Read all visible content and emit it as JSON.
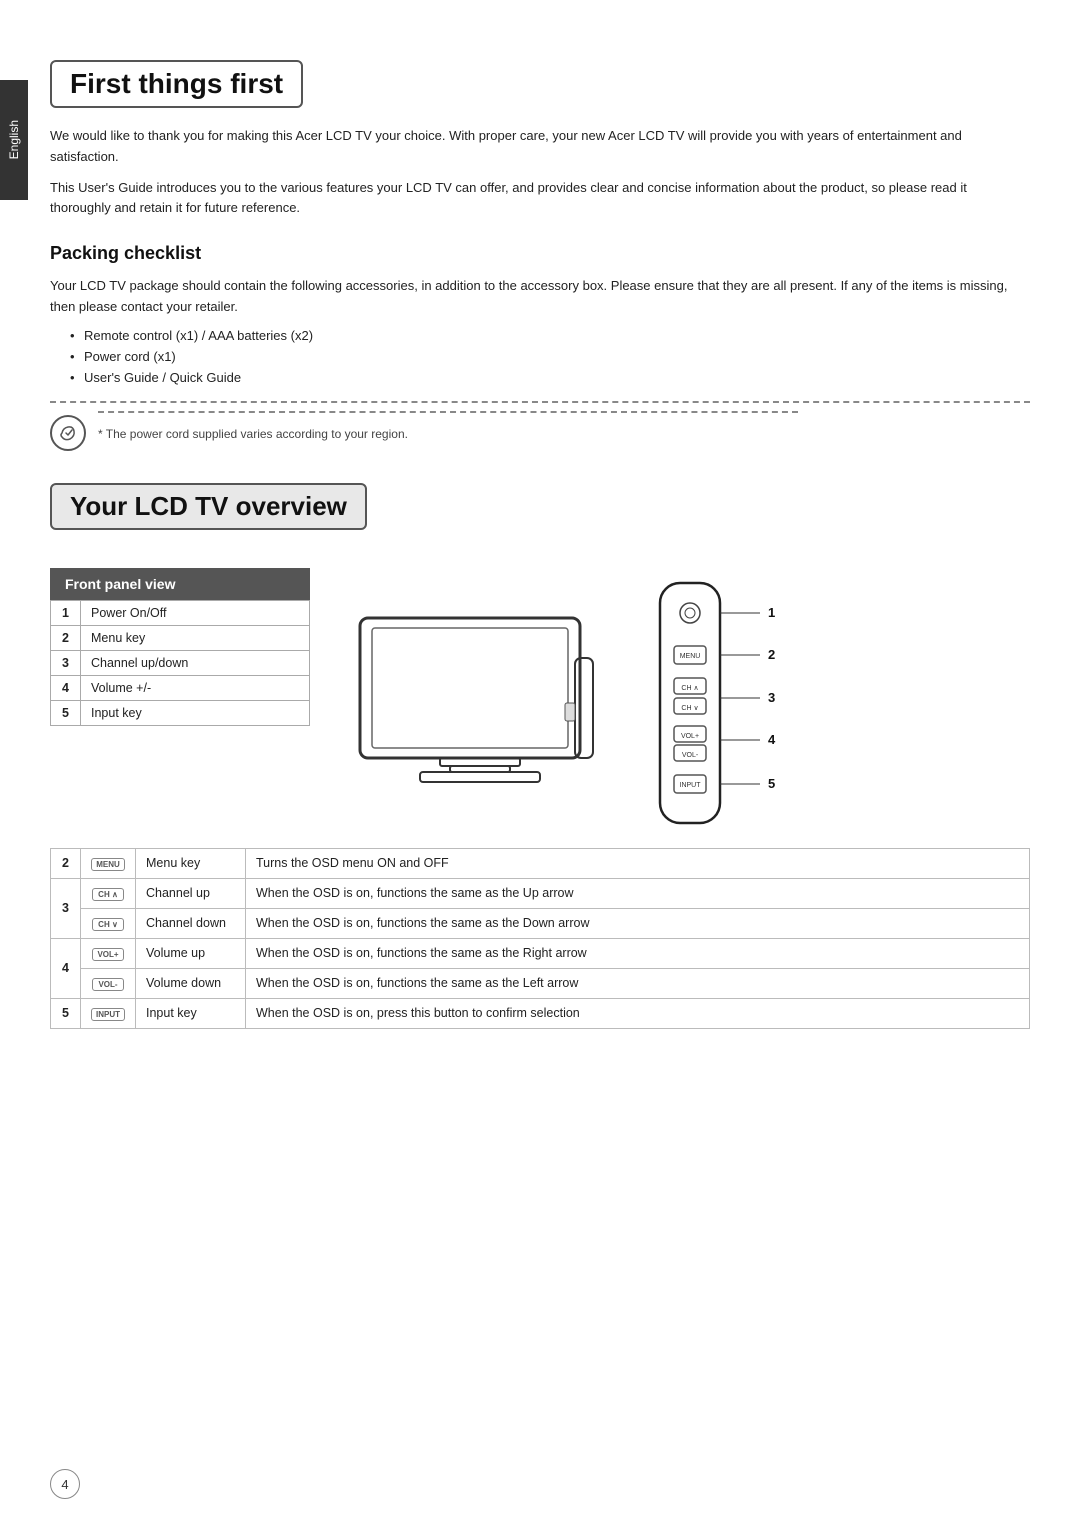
{
  "sidetab": {
    "label": "English"
  },
  "section1": {
    "title": "First things first",
    "para1": "We would like to thank you for making this Acer LCD TV your choice. With proper care, your new Acer LCD TV will provide you with years of entertainment and satisfaction.",
    "para2": "This User's Guide introduces you to the various features your LCD TV can offer, and provides clear and concise information about the product, so please read it thoroughly and retain it for future reference."
  },
  "packing": {
    "title": "Packing checklist",
    "intro": "Your LCD TV package should contain the following accessories, in addition to the accessory box. Please ensure that they are all present. If any of the items is missing, then please contact your retailer.",
    "items": [
      "Remote control (x1) / AAA batteries (x2)",
      "Power cord (x1)",
      "User's Guide / Quick Guide"
    ],
    "note": "* The power cord supplied varies according to your region."
  },
  "section2": {
    "title": "Your LCD TV overview",
    "frontPanel": {
      "title": "Front panel view",
      "rows": [
        {
          "num": "1",
          "label": "Power On/Off"
        },
        {
          "num": "2",
          "label": "Menu key"
        },
        {
          "num": "3",
          "label": "Channel up/down"
        },
        {
          "num": "4",
          "label": "Volume +/-"
        },
        {
          "num": "5",
          "label": "Input key"
        }
      ]
    },
    "detailRows": [
      {
        "num": "2",
        "icon": "MENU",
        "keyName": "Menu key",
        "desc": "Turns the OSD menu ON and OFF",
        "rowspan": 1
      },
      {
        "num": "3",
        "icon": "CH ∧",
        "keyName": "Channel up",
        "desc": "When the OSD is on, functions the same as the Up arrow",
        "rowspan": 2
      },
      {
        "num": "",
        "icon": "CH ∨",
        "keyName": "Channel down",
        "desc": "When the OSD is on, functions the same as the Down arrow",
        "rowspan": 0
      },
      {
        "num": "4",
        "icon": "VOL+",
        "keyName": "Volume up",
        "desc": "When the OSD is on, functions the same as the Right arrow",
        "rowspan": 2
      },
      {
        "num": "",
        "icon": "VOL-",
        "keyName": "Volume down",
        "desc": "When the OSD is on, functions the same as the Left arrow",
        "rowspan": 0
      },
      {
        "num": "5",
        "icon": "INPUT",
        "keyName": "Input key",
        "desc": "When the OSD is on, press this button to confirm selection",
        "rowspan": 1
      }
    ]
  },
  "pageNum": "4"
}
